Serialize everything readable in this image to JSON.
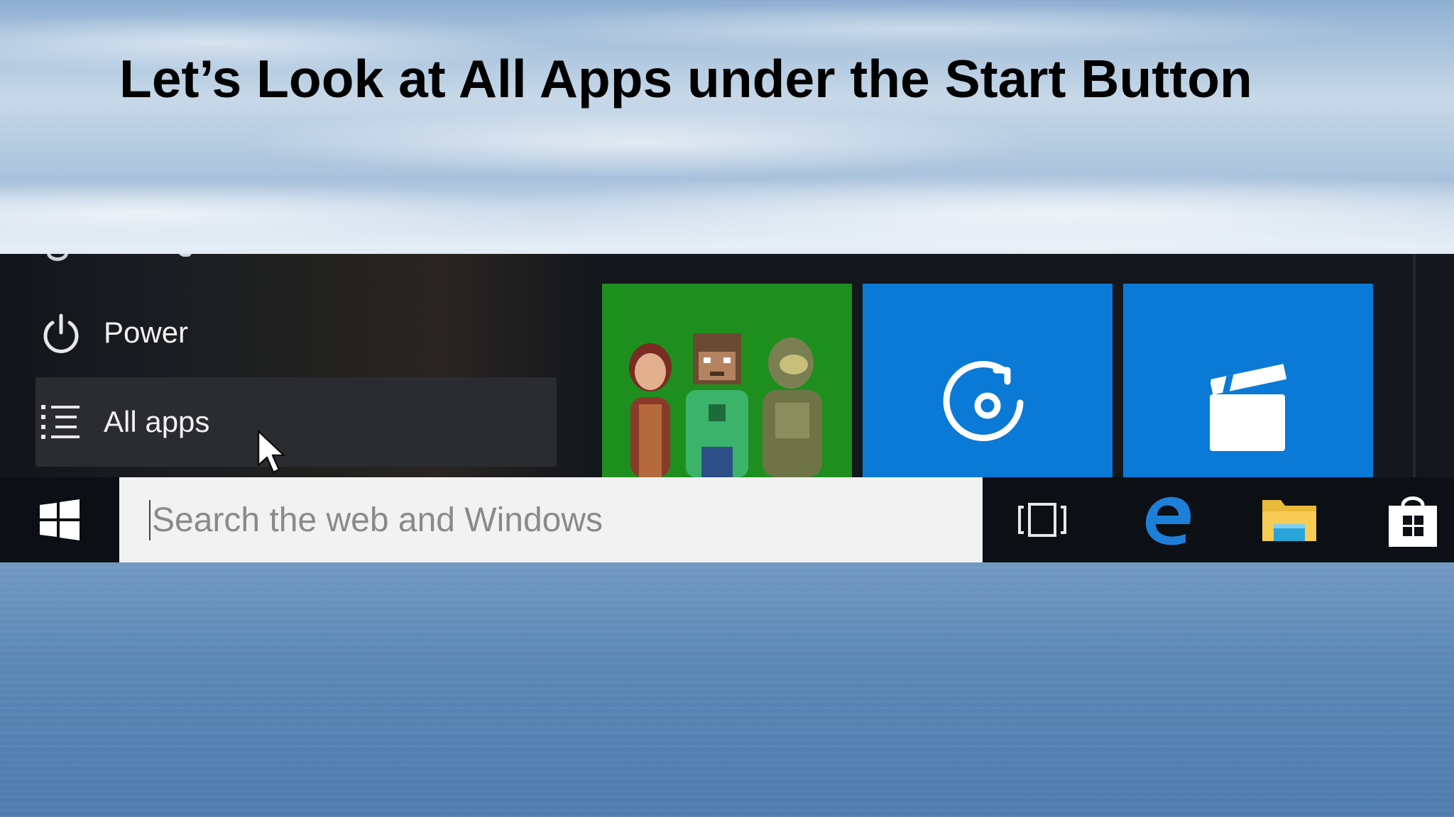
{
  "slide": {
    "title": "Let’s Look at All Apps under the Start Button"
  },
  "start_menu": {
    "items": [
      {
        "label": "Power",
        "icon": "power-icon"
      },
      {
        "label": "All apps",
        "icon": "list-icon"
      }
    ],
    "tiles": [
      {
        "app": "Xbox",
        "icon": "xbox-avatars",
        "color": "#1e8f1e"
      },
      {
        "app": "Groove Music",
        "icon": "groove-music-icon",
        "color": "#0a7ad6"
      },
      {
        "app": "Movies & TV",
        "icon": "clapperboard-icon",
        "color": "#0a7ad6"
      }
    ]
  },
  "taskbar": {
    "search": {
      "placeholder": "Search the web and Windows",
      "value": ""
    },
    "icons": [
      "windows-logo-icon",
      "task-view-icon",
      "edge-icon",
      "file-explorer-icon",
      "store-icon"
    ]
  },
  "colors": {
    "taskbar": "#0c0f14",
    "menu_bg": "#14171c",
    "tile_green": "#1e8f1e",
    "tile_blue": "#0a7ad6"
  }
}
